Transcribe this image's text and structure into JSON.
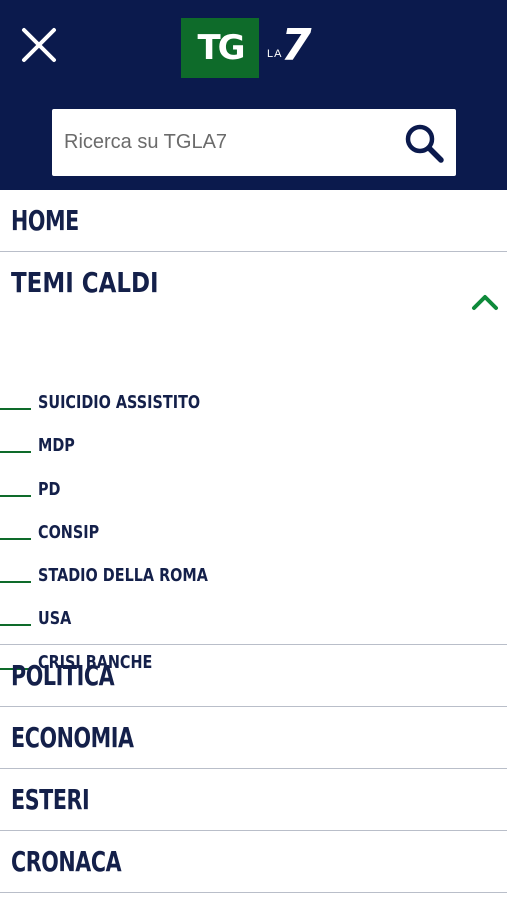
{
  "header": {
    "logo": {
      "tg": "TG",
      "la": "LA",
      "seven": "7"
    },
    "search": {
      "placeholder": "Ricerca su TGLA7"
    }
  },
  "colors": {
    "header_bg": "#0b1a4d",
    "accent_green": "#0e6b2a",
    "text_navy": "#14204a",
    "divider": "#b9bec9"
  },
  "menu": {
    "home": "HOME",
    "temi_caldi": {
      "label": "TEMI CALDI",
      "expanded": true,
      "items": [
        "SUICIDIO ASSISTITO",
        "MDP",
        "PD",
        "CONSIP",
        "STADIO DELLA ROMA",
        "USA",
        "CRISI BANCHE"
      ]
    },
    "sections": [
      "POLITICA",
      "ECONOMIA",
      "ESTERI",
      "CRONACA"
    ]
  },
  "icons": {
    "close": "close-icon",
    "search": "search-icon",
    "expand": "chevron-up-icon"
  }
}
